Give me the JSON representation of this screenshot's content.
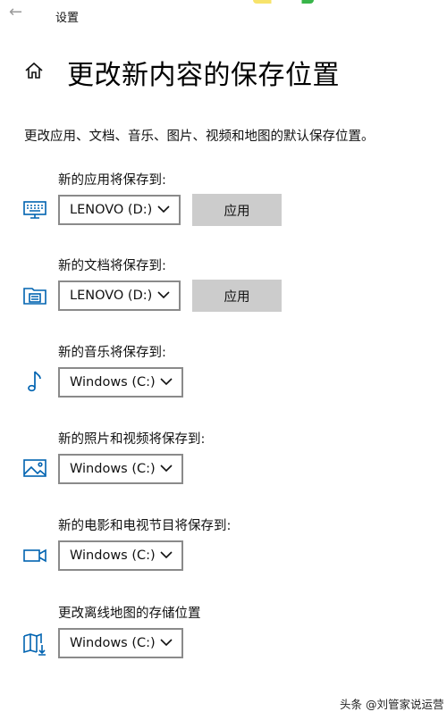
{
  "window": {
    "title": "设置",
    "back_icon": "back-arrow-icon"
  },
  "page": {
    "title": "更改新内容的保存位置",
    "description": "更改应用、文档、音乐、图片、视频和地图的默认保存位置。"
  },
  "sections": [
    {
      "label": "新的应用将保存到:",
      "icon": "monitor-icon",
      "drive": "LENOVO (D:)",
      "apply_label": "应用"
    },
    {
      "label": "新的文档将保存到:",
      "icon": "folder-document-icon",
      "drive": "LENOVO (D:)",
      "apply_label": "应用"
    },
    {
      "label": "新的音乐将保存到:",
      "icon": "music-note-icon",
      "drive": "Windows (C:)"
    },
    {
      "label": "新的照片和视频将保存到:",
      "icon": "image-icon",
      "drive": "Windows (C:)"
    },
    {
      "label": "新的电影和电视节目将保存到:",
      "icon": "video-camera-icon",
      "drive": "Windows (C:)"
    },
    {
      "label": "更改离线地图的存储位置",
      "icon": "map-download-icon",
      "drive": "Windows (C:)"
    }
  ],
  "watermark": "头条 @刘管家说运营",
  "colors": {
    "accent": "#0063b1",
    "button": "#cccccc",
    "border": "#8a8a8a"
  }
}
